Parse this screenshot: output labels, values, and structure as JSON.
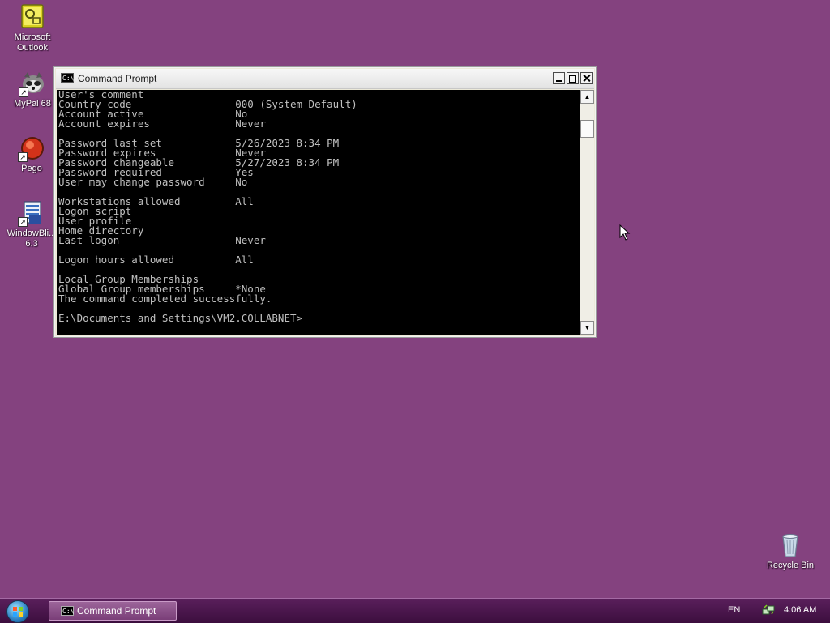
{
  "desktop": {
    "icons": [
      {
        "label": "Microsoft\nOutlook",
        "icon": "outlook-icon"
      },
      {
        "label": "MyPal 68",
        "icon": "mypal-icon"
      },
      {
        "label": "Pego",
        "icon": "pego-icon"
      },
      {
        "label": "WindowBli...\n6.3",
        "icon": "windowblinds-icon"
      },
      {
        "label": "Recycle Bin",
        "icon": "recycle-bin-icon"
      }
    ]
  },
  "window": {
    "title": "Command Prompt",
    "icon": "cmd-icon",
    "icon_text": "C:\\",
    "console_lines": [
      "User's comment",
      "Country code                 000 (System Default)",
      "Account active               No",
      "Account expires              Never",
      "",
      "Password last set            5/26/2023 8:34 PM",
      "Password expires             Never",
      "Password changeable          5/27/2023 8:34 PM",
      "Password required            Yes",
      "User may change password     No",
      "",
      "Workstations allowed         All",
      "Logon script",
      "User profile",
      "Home directory",
      "Last logon                   Never",
      "",
      "Logon hours allowed          All",
      "",
      "Local Group Memberships",
      "Global Group memberships     *None",
      "The command completed successfully.",
      "",
      "E:\\Documents and Settings\\VM2.COLLABNET>"
    ]
  },
  "taskbar": {
    "start_icon": "windows-start-orb-icon",
    "tasks": [
      {
        "label": "Command Prompt",
        "icon": "cmd-icon",
        "icon_text": "C:\\"
      }
    ],
    "tray": {
      "language": "EN",
      "network_icon": "network-icon",
      "clock": "4:06 AM"
    }
  }
}
